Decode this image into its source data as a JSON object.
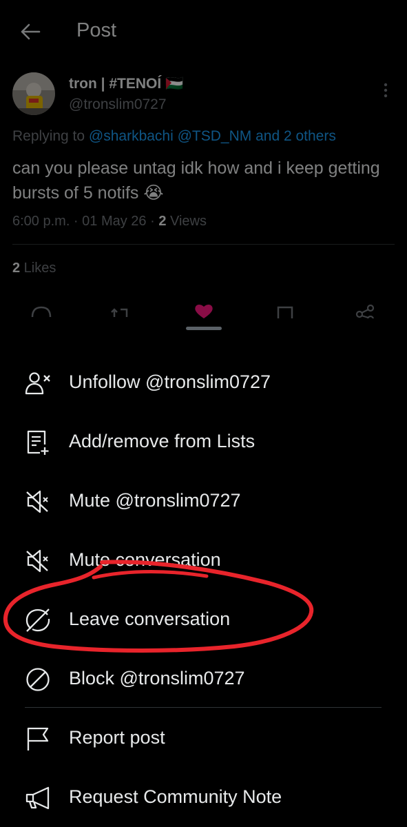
{
  "header": {
    "title": "Post",
    "back_icon": "arrow-left-icon"
  },
  "post": {
    "display_name": "tron | #TENOÍ 🇵🇸",
    "handle": "@tronslim0727",
    "replying_prefix": "Replying to",
    "replying_mentions": "@sharkbachi @TSD_NM and 2 others",
    "text": "can you please untag idk how and i keep getting bursts of 5 notifs 😭",
    "time": "6:00 p.m. · 01 May 26 · ",
    "views_count": "2",
    "views_label": " Views",
    "likes_count": "2",
    "likes_label": " Likes"
  },
  "actions": [
    "reply-icon",
    "repost-icon",
    "like-icon",
    "bookmark-icon",
    "share-icon"
  ],
  "menu": {
    "items": [
      {
        "label": "Unfollow @tronslim0727",
        "icon": "unfollow-user-icon"
      },
      {
        "label": "Add/remove from Lists",
        "icon": "list-add-icon"
      },
      {
        "label": "Mute @tronslim0727",
        "icon": "mute-icon"
      },
      {
        "label": "Mute conversation",
        "icon": "mute-icon"
      },
      {
        "label": "Leave conversation",
        "icon": "leave-conversation-icon"
      },
      {
        "label": "Block @tronslim0727",
        "icon": "block-icon"
      },
      {
        "label": "Report post",
        "icon": "flag-icon"
      },
      {
        "label": "Request Community Note",
        "icon": "megaphone-icon"
      }
    ]
  },
  "colors": {
    "background": "#000000",
    "text": "#e7e9ea",
    "muted": "#71767b",
    "link": "#1d9bf0",
    "like": "#f91880",
    "annotation": "#e8242b"
  }
}
